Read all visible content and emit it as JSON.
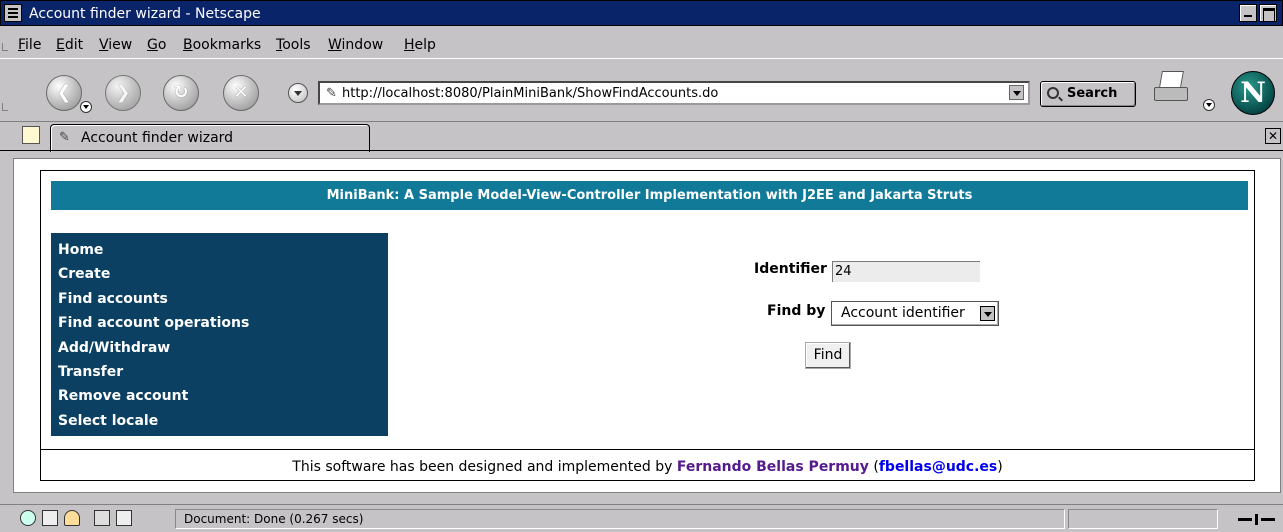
{
  "window": {
    "title": "Account finder wizard - Netscape"
  },
  "menu": {
    "items": [
      {
        "label": "File",
        "u": "F",
        "rest": "ile"
      },
      {
        "label": "Edit",
        "u": "E",
        "rest": "dit"
      },
      {
        "label": "View",
        "u": "V",
        "rest": "iew"
      },
      {
        "label": "Go",
        "u": "G",
        "rest": "o"
      },
      {
        "label": "Bookmarks",
        "u": "B",
        "rest": "ookmarks"
      },
      {
        "label": "Tools",
        "u": "T",
        "rest": "ools"
      },
      {
        "label": "Window",
        "u": "W",
        "rest": "indow"
      },
      {
        "label": "Help",
        "u": "H",
        "rest": "elp"
      }
    ]
  },
  "toolbar": {
    "url": "http://localhost:8080/PlainMiniBank/ShowFindAccounts.do",
    "search_label": "Search",
    "logo_letter": "N"
  },
  "tabs": {
    "active_label": "Account finder wizard"
  },
  "page": {
    "banner": "MiniBank: A Sample Model-View-Controller Implementation with J2EE and Jakarta Struts",
    "nav": [
      "Home",
      "Create",
      "Find accounts",
      "Find account operations",
      "Add/Withdraw",
      "Transfer",
      "Remove account",
      "Select locale"
    ],
    "form": {
      "identifier_label": "Identifier",
      "identifier_value": "24",
      "find_by_label": "Find by",
      "find_by_selected": "Account identifier",
      "find_button": "Find"
    },
    "footer": {
      "prefix": "This software has been designed and implemented by",
      "author": "Fernando Bellas Permuy",
      "open_paren": "(",
      "email": "fbellas@udc.es",
      "close_paren": ")"
    }
  },
  "status": {
    "text": "Document: Done (0.267 secs)"
  },
  "colors": {
    "banner_bg": "#117a99",
    "sidebar_bg": "#0b4063",
    "titlebar_bg": "#0a246a",
    "chrome_bg": "#c6c3c6"
  }
}
